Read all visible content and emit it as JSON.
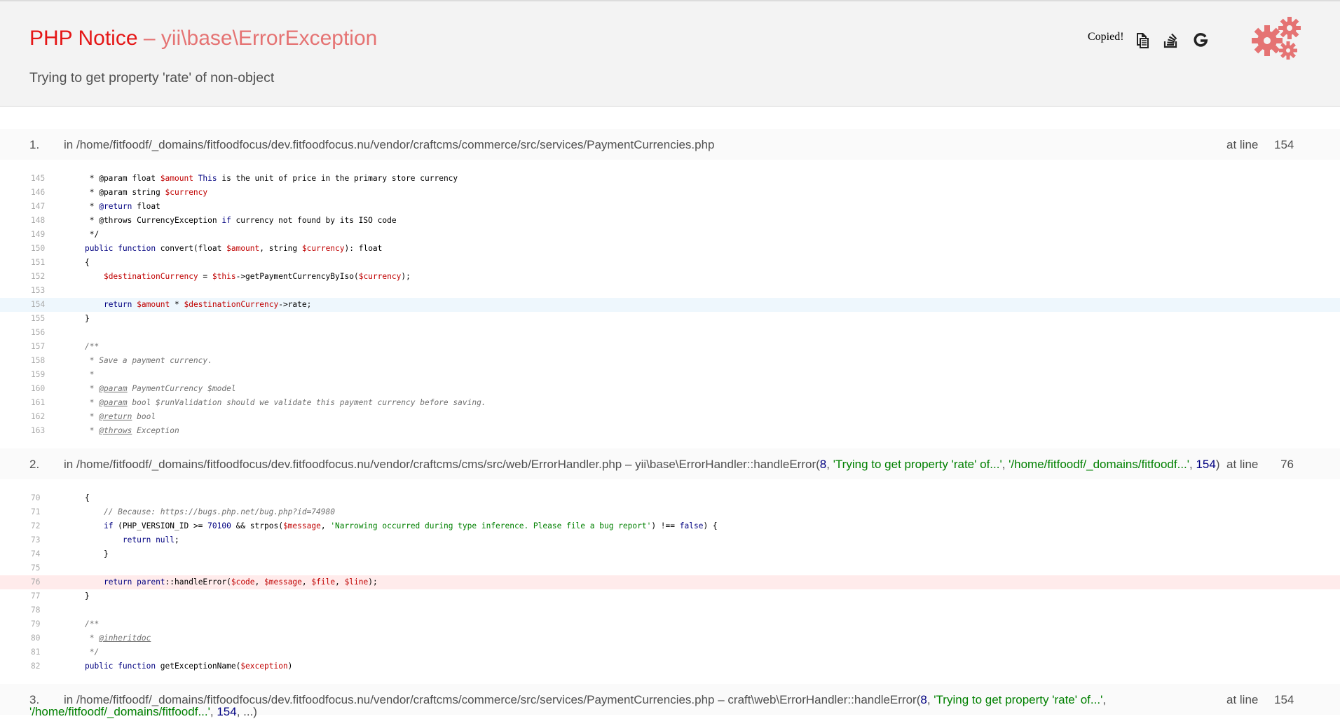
{
  "header": {
    "type": "PHP Notice",
    "separator": " – ",
    "exception_class": "yii\\base\\ErrorException",
    "message": "Trying to get property 'rate' of non-object",
    "copied_label": "Copied!",
    "tool_icons": [
      "copy-icon",
      "stackoverflow-icon",
      "google-icon"
    ],
    "logo_icon": "gears-icon",
    "colors": {
      "title": "#e51717",
      "subtitle": "#e57373",
      "gears": "#e57373",
      "header_bg": "#f3f3f3"
    }
  },
  "call_stack": [
    {
      "num": "1.",
      "in": "in ",
      "file": "/home/fitfoodf/_domains/fitfoodfocus/dev.fitfoodfocus.nu/vendor/craftcms/commerce/src/services/PaymentCurrencies.php",
      "at_line_label": "at line",
      "line": "154",
      "code": {
        "n0": "145",
        "l0": " * @param float $amount This is the unit of price in the primary store currency",
        "n1": "146",
        "l1": " * @param string $currency",
        "n2": "147",
        "l2": " * @return float",
        "n3": "148",
        "l3": " * @throws CurrencyException if currency not found by its ISO code",
        "n4": "149",
        "l4": " */",
        "n5": "150",
        "l5": "public function convert(float $amount, string $currency): float",
        "n6": "151",
        "l6": "{",
        "n7": "152",
        "l7": "    $destinationCurrency = $this->getPaymentCurrencyByIso($currency);",
        "n8": "153",
        "l8": "",
        "n9": "154",
        "l9": "    return $amount * $destinationCurrency->rate;",
        "n10": "155",
        "l10": "}",
        "n11": "156",
        "l11": "",
        "n12": "157",
        "l12": "/**",
        "n13": "158",
        "l13": " * Save a payment currency.",
        "n14": "159",
        "l14": " *",
        "n15": "160",
        "l15": " * @param PaymentCurrency $model",
        "n16": "161",
        "l16": " * @param bool $runValidation should we validate this payment currency before saving.",
        "n17": "162",
        "l17": " * @return bool",
        "n18": "163",
        "l18": " * @throws Exception"
      }
    },
    {
      "num": "2.",
      "in": "in ",
      "file": "/home/fitfoodf/_domains/fitfoodfocus/dev.fitfoodfocus.nu/vendor/craftcms/cms/src/web/ErrorHandler.php",
      "sep": " – ",
      "func": "yii\\base\\ErrorHandler::handleError(",
      "arg1": "8",
      "comma": ", ",
      "arg2": "'Trying to get property 'rate' of...'",
      "arg3": "'/home/fitfoodf/_domains/fitfoodf...'",
      "arg4": "154",
      "close": ")",
      "at_line_label": "at line",
      "line": "76",
      "code": {
        "n0": "70",
        "l0": "{",
        "n1": "71",
        "l1": "    // Because: https://bugs.php.net/bug.php?id=74980",
        "n2": "72",
        "l2": "    if (PHP_VERSION_ID >= 70100 && strpos($message, 'Narrowing occurred during type inference. Please file a bug report') !== false) {",
        "n3": "73",
        "l3": "        return null;",
        "n4": "74",
        "l4": "    }",
        "n5": "75",
        "l5": "",
        "n6": "76",
        "l6": "    return parent::handleError($code, $message, $file, $line);",
        "n7": "77",
        "l7": "}",
        "n8": "78",
        "l8": "",
        "n9": "79",
        "l9": "/**",
        "n10": "80",
        "l10": " * @inheritdoc",
        "n11": "81",
        "l11": " */",
        "n12": "82",
        "l12": "public function getExceptionName($exception)"
      }
    },
    {
      "num": "3.",
      "in": "in ",
      "file": "/home/fitfoodf/_domains/fitfoodfocus/dev.fitfoodfocus.nu/vendor/craftcms/commerce/src/services/PaymentCurrencies.php",
      "sep": " – ",
      "func": "craft\\web\\ErrorHandler::handleError(",
      "arg1": "8",
      "comma": ", ",
      "arg2": "'Trying to get property 'rate' of...'",
      "arg3": "'/home/fitfoodf/_domains/fitfoodf...'",
      "arg4": "154",
      "tail": ", ...)",
      "at_line_label": "at line",
      "line": "154"
    }
  ]
}
